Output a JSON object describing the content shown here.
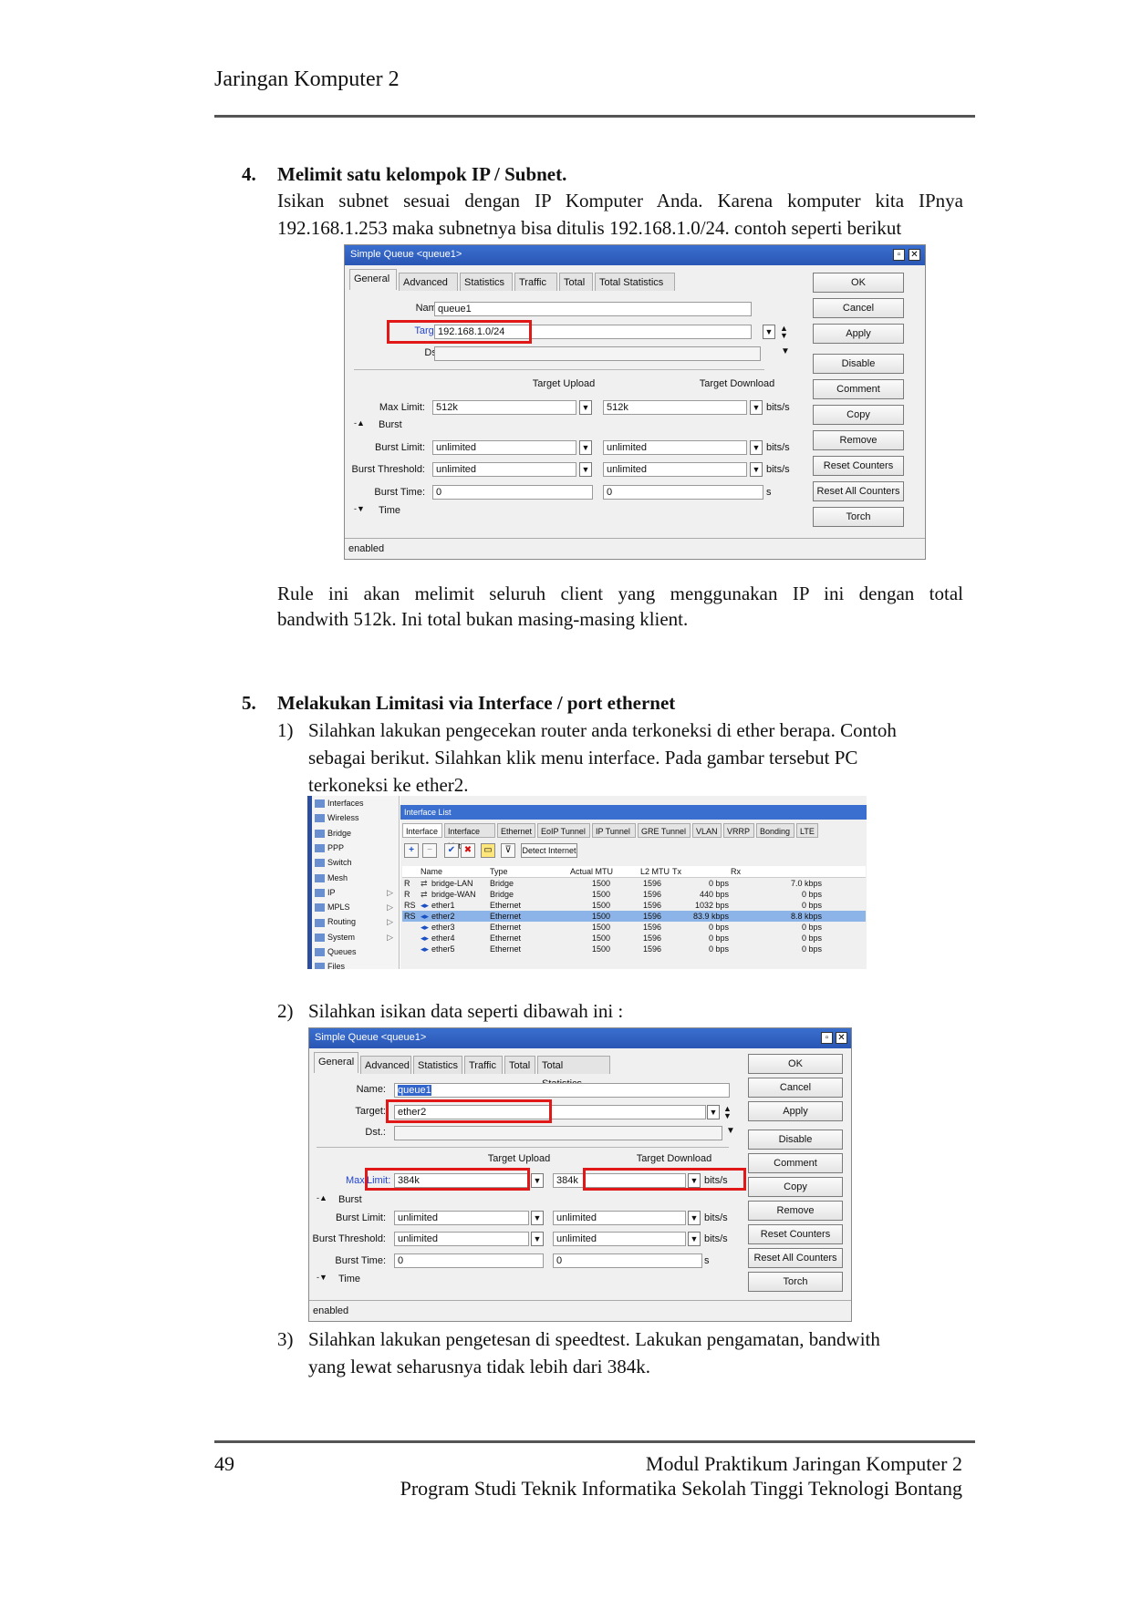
{
  "header": {
    "title": "Jaringan Komputer 2"
  },
  "section4": {
    "number": "4.",
    "heading": "Melimit satu kelompok IP / Subnet.",
    "para_line1": "Isikan subnet sesuai dengan IP Komputer Anda. Karena komputer kita IPnya",
    "para_line2": "192.168.1.253 maka subnetnya bisa ditulis 192.168.1.0/24. contoh seperti berikut",
    "after_line1": "Rule ini akan melimit seluruh client yang menggunakan IP ini dengan total",
    "after_line2": "bandwith 512k. Ini total bukan masing-masing klient."
  },
  "dialog1": {
    "title": "Simple Queue <queue1>",
    "tabs": [
      "General",
      "Advanced",
      "Statistics",
      "Traffic",
      "Total",
      "Total Statistics"
    ],
    "buttons": [
      "OK",
      "Cancel",
      "Apply",
      "Disable",
      "Comment",
      "Copy",
      "Remove",
      "Reset Counters",
      "Reset All Counters",
      "Torch"
    ],
    "name_label": "Name:",
    "name_value": "queue1",
    "target_label": "Target:",
    "target_value": "192.168.1.0/24",
    "dst_label": "Dst.:",
    "col_upload": "Target Upload",
    "col_download": "Target Download",
    "max_limit_label": "Max Limit:",
    "max_up": "512k",
    "max_down": "512k",
    "burst_label": "Burst",
    "burst_limit_label": "Burst Limit:",
    "burst_limit_up": "unlimited",
    "burst_limit_down": "unlimited",
    "burst_threshold_label": "Burst Threshold:",
    "burst_threshold_up": "unlimited",
    "burst_threshold_down": "unlimited",
    "burst_time_label": "Burst Time:",
    "burst_time_up": "0",
    "burst_time_down": "0",
    "time_label": "Time",
    "unit_bits": "bits/s",
    "unit_s": "s",
    "status": "enabled"
  },
  "section5": {
    "number": "5.",
    "heading": "Melakukan Limitasi via Interface / port ethernet",
    "step1_num": "1)",
    "step1_line1": "Silahkan lakukan pengecekan router anda terkoneksi di ether berapa. Contoh",
    "step1_line2": "sebagai berikut. Silahkan klik menu interface. Pada gambar tersebut PC",
    "step1_line3": "terkoneksi ke ether2.",
    "step2_num": "2)",
    "step2_text": "Silahkan isikan data seperti dibawah ini :",
    "step3_num": "3)",
    "step3_line1": "Silahkan lakukan pengetesan di speedtest. Lakukan pengamatan, bandwith",
    "step3_line2": "yang lewat seharusnya tidak lebih dari 384k."
  },
  "interfaces": {
    "menu": [
      {
        "label": "Interfaces",
        "arrow": ""
      },
      {
        "label": "Wireless",
        "arrow": ""
      },
      {
        "label": "Bridge",
        "arrow": ""
      },
      {
        "label": "PPP",
        "arrow": ""
      },
      {
        "label": "Switch",
        "arrow": ""
      },
      {
        "label": "Mesh",
        "arrow": ""
      },
      {
        "label": "IP",
        "arrow": "▷"
      },
      {
        "label": "MPLS",
        "arrow": "▷"
      },
      {
        "label": "Routing",
        "arrow": "▷"
      },
      {
        "label": "System",
        "arrow": "▷"
      },
      {
        "label": "Queues",
        "arrow": ""
      },
      {
        "label": "Files",
        "arrow": ""
      }
    ],
    "title": "Interface List",
    "tabs": [
      "Interface",
      "Interface List",
      "Ethernet",
      "EoIP Tunnel",
      "IP Tunnel",
      "GRE Tunnel",
      "VLAN",
      "VRRP",
      "Bonding",
      "LTE"
    ],
    "detect_button": "Detect Internet",
    "columns": [
      "Name",
      "Type",
      "Actual MTU",
      "L2 MTU",
      "Tx",
      "Rx"
    ],
    "rows": [
      {
        "flag": "R",
        "name": "bridge-LAN",
        "type": "Bridge",
        "mtu": "1500",
        "l2mtu": "1596",
        "tx": "0 bps",
        "rx": "7.0 kbps"
      },
      {
        "flag": "R",
        "name": "bridge-WAN",
        "type": "Bridge",
        "mtu": "1500",
        "l2mtu": "1596",
        "tx": "440 bps",
        "rx": "0 bps"
      },
      {
        "flag": "RS",
        "name": "ether1",
        "type": "Ethernet",
        "mtu": "1500",
        "l2mtu": "1596",
        "tx": "1032 bps",
        "rx": "0 bps"
      },
      {
        "flag": "RS",
        "name": "ether2",
        "type": "Ethernet",
        "mtu": "1500",
        "l2mtu": "1596",
        "tx": "83.9 kbps",
        "rx": "8.8 kbps"
      },
      {
        "flag": "",
        "name": "ether3",
        "type": "Ethernet",
        "mtu": "1500",
        "l2mtu": "1596",
        "tx": "0 bps",
        "rx": "0 bps"
      },
      {
        "flag": "",
        "name": "ether4",
        "type": "Ethernet",
        "mtu": "1500",
        "l2mtu": "1596",
        "tx": "0 bps",
        "rx": "0 bps"
      },
      {
        "flag": "",
        "name": "ether5",
        "type": "Ethernet",
        "mtu": "1500",
        "l2mtu": "1596",
        "tx": "0 bps",
        "rx": "0 bps"
      }
    ]
  },
  "dialog2": {
    "title": "Simple Queue <queue1>",
    "tabs": [
      "General",
      "Advanced",
      "Statistics",
      "Traffic",
      "Total",
      "Total Statistics"
    ],
    "buttons": [
      "OK",
      "Cancel",
      "Apply",
      "Disable",
      "Comment",
      "Copy",
      "Remove",
      "Reset Counters",
      "Reset All Counters",
      "Torch"
    ],
    "name_label": "Name:",
    "name_value": "queue1",
    "target_label": "Target:",
    "target_value": "ether2",
    "dst_label": "Dst.:",
    "col_upload": "Target Upload",
    "col_download": "Target Download",
    "max_label_a": "Max",
    "max_label_b": "Limit:",
    "max_up": "384k",
    "max_down": "384k",
    "burst_label": "Burst",
    "burst_limit_label": "Burst Limit:",
    "burst_limit_up": "unlimited",
    "burst_limit_down": "unlimited",
    "burst_threshold_label": "Burst Threshold:",
    "burst_threshold_up": "unlimited",
    "burst_threshold_down": "unlimited",
    "burst_time_label": "Burst Time:",
    "burst_time_up": "0",
    "burst_time_down": "0",
    "time_label": "Time",
    "unit_bits": "bits/s",
    "unit_s": "s",
    "status": "enabled"
  },
  "footer": {
    "page_number": "49",
    "line1": "Modul Praktikum Jaringan Komputer 2",
    "line2": "Program Studi Teknik Informatika Sekolah Tinggi Teknologi Bontang"
  }
}
